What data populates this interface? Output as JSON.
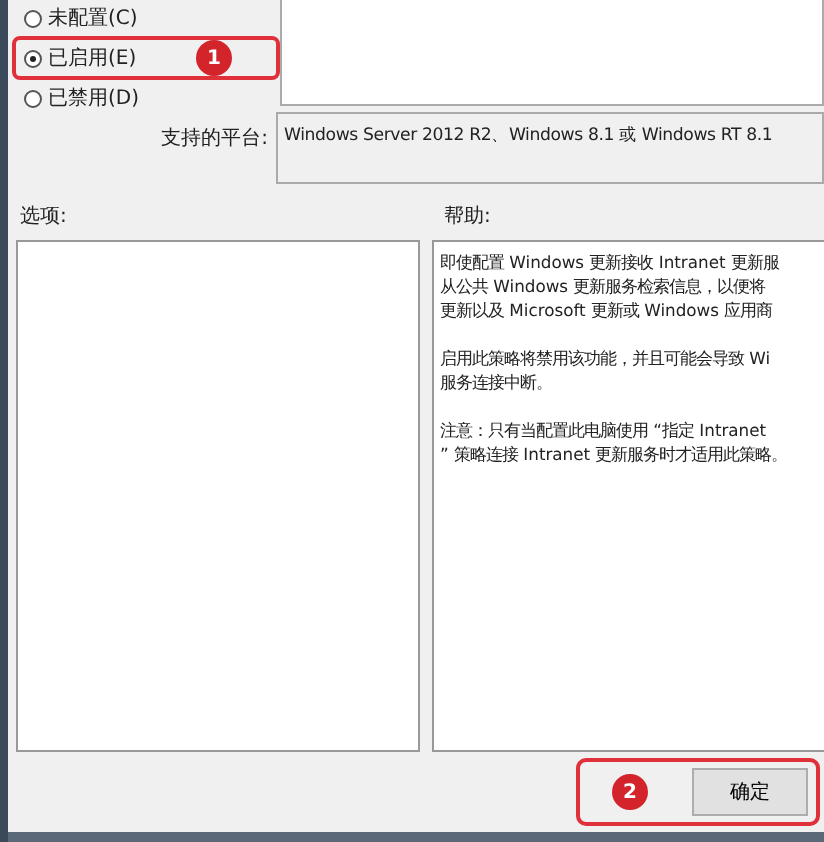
{
  "radios": [
    {
      "label": "未配置(C)",
      "selected": false,
      "highlighted": false
    },
    {
      "label": "已启用(E)",
      "selected": true,
      "highlighted": true,
      "badge": "1"
    },
    {
      "label": "已禁用(D)",
      "selected": false,
      "highlighted": false
    }
  ],
  "platform": {
    "label": "支持的平台:",
    "value": "Windows Server 2012 R2、Windows 8.1 或 Windows RT 8.1"
  },
  "options": {
    "label": "选项:"
  },
  "help": {
    "label": "帮助:",
    "paragraphs": [
      [
        "即使配置 Windows 更新接收 Intranet 更新服",
        "从公共 Windows 更新服务检索信息，以便将",
        "更新以及 Microsoft 更新或 Windows 应用商"
      ],
      [
        "启用此策略将禁用该功能，并且可能会导致 Wi",
        "服务连接中断。"
      ],
      [
        "注意：只有当配置此电脑使用 “指定 Intranet",
        "” 策略连接 Intranet 更新服务时才适用此策略。"
      ]
    ]
  },
  "ok_button": {
    "label": "确定",
    "highlighted": true,
    "badge": "2"
  }
}
